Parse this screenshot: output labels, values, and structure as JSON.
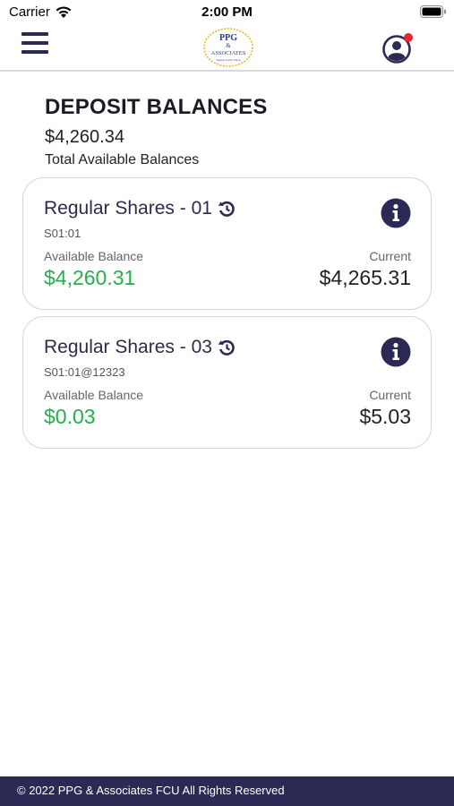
{
  "status_bar": {
    "carrier": "Carrier",
    "time": "2:00 PM",
    "wifi_icon": "wifi-icon",
    "battery_icon": "battery-icon"
  },
  "nav": {
    "menu_icon": "hamburger-menu-icon",
    "logo": {
      "line1": "PPG",
      "line2": "&",
      "line3": "ASSOCIATES",
      "line4": "Federal Credit Union"
    },
    "profile_icon": "user-profile-icon",
    "notification_dot_color": "#e8262b"
  },
  "balances": {
    "title": "DEPOSIT BALANCES",
    "total_amount": "$4,260.34",
    "total_label": "Total Available Balances"
  },
  "accounts": [
    {
      "name": "Regular Shares - 01",
      "id": "S01:01",
      "available_label": "Available Balance",
      "available_value": "$4,260.31",
      "current_label": "Current",
      "current_value": "$4,265.31"
    },
    {
      "name": "Regular Shares - 03",
      "id": "S01:01@12323",
      "available_label": "Available Balance",
      "available_value": "$0.03",
      "current_label": "Current",
      "current_value": "$5.03"
    }
  ],
  "footer": {
    "text": "© 2022 PPG & Associates FCU All Rights Reserved"
  },
  "colors": {
    "brand_navy": "#2b2a55",
    "positive_green": "#22b04b",
    "logo_gold": "#e7b82a"
  }
}
